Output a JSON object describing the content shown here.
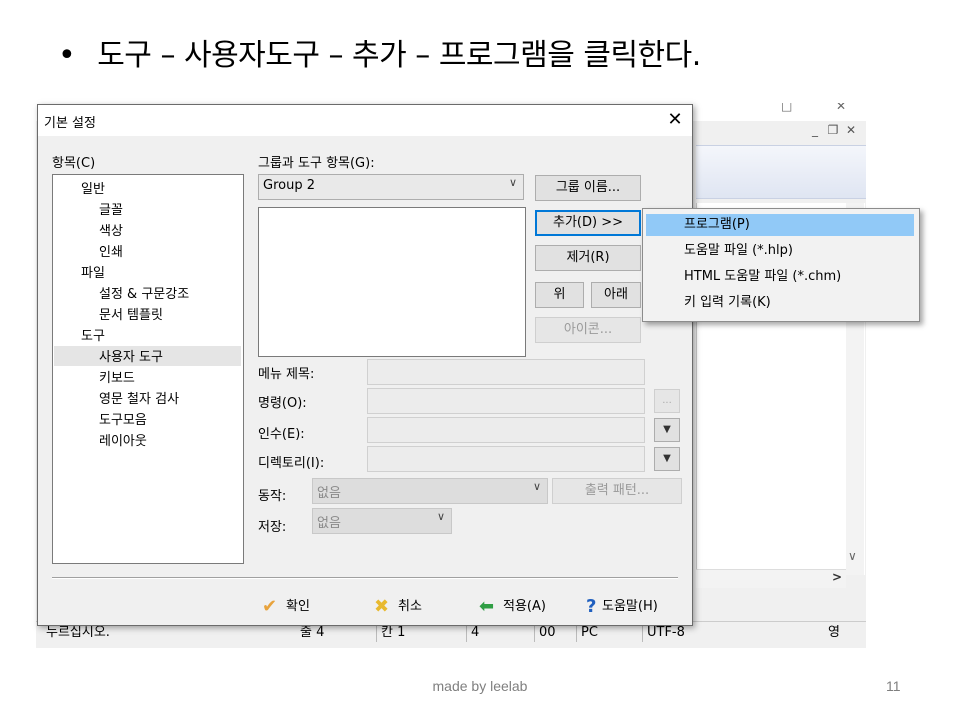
{
  "slide": {
    "bullet": "•",
    "title": "도구 – 사용자도구 – 추가 – 프로그램을 클릭한다.",
    "footer": "made by leelab",
    "page_number": "11"
  },
  "background_window": {
    "title_controls": [
      "–",
      "□",
      "✕"
    ],
    "mdi_controls": [
      "_",
      "🗗",
      "✕"
    ],
    "statusbar": {
      "message": "누르십시오.",
      "line": "줄 4",
      "col": "칸 1",
      "num": "4",
      "ins": "00",
      "mode": "PC",
      "encoding": "UTF-8",
      "lang": "영"
    }
  },
  "dialog": {
    "title": "기본 설정",
    "close": "✕",
    "categories_label": "항목(C)",
    "tree": [
      {
        "label": "일반",
        "level": 0
      },
      {
        "label": "글꼴",
        "level": 1
      },
      {
        "label": "색상",
        "level": 1
      },
      {
        "label": "인쇄",
        "level": 1
      },
      {
        "label": "파일",
        "level": 0
      },
      {
        "label": "설정 & 구문강조",
        "level": 1
      },
      {
        "label": "문서 템플릿",
        "level": 1
      },
      {
        "label": "도구",
        "level": 0
      },
      {
        "label": "사용자 도구",
        "level": 1,
        "selected": true
      },
      {
        "label": "키보드",
        "level": 1
      },
      {
        "label": "영문 철자 검사",
        "level": 1
      },
      {
        "label": "도구모음",
        "level": 1
      },
      {
        "label": "레이아웃",
        "level": 1
      }
    ],
    "group_label": "그룹과 도구 항목(G):",
    "group_value": "Group 2",
    "buttons": {
      "rename_group": "그룹 이름...",
      "add": "추가(D) >>",
      "remove": "제거(R)",
      "up": "위",
      "down": "아래",
      "icon": "아이콘..."
    },
    "fields": {
      "menu_title": "메뉴 제목:",
      "command": "명령(O):",
      "arguments": "인수(E):",
      "directory": "디렉토리(I):",
      "action": "동작:",
      "action_value": "없음",
      "output_pattern": "출력 패턴...",
      "save": "저장:",
      "save_value": "없음",
      "browse": "..."
    },
    "footer": {
      "ok": "확인",
      "cancel": "취소",
      "apply": "적용(A)",
      "help": "도움말(H)"
    }
  },
  "popup_menu": {
    "items": [
      {
        "label": "프로그램(P)",
        "highlighted": true
      },
      {
        "label": "도움말 파일 (*.hlp)"
      },
      {
        "label": "HTML 도움말 파일 (*.chm)"
      },
      {
        "label": "키 입력 기록(K)"
      }
    ]
  },
  "colors": {
    "highlight": "#91c9f7",
    "focus_border": "#0078d7",
    "ok_icon": "#e8a33d",
    "cancel_icon": "#e8b92f",
    "apply_icon": "#2f9e44",
    "help_icon": "#1f5fbf"
  }
}
